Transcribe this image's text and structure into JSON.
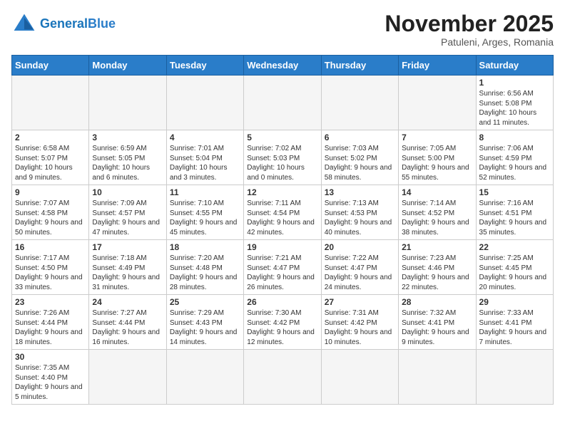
{
  "header": {
    "logo_general": "General",
    "logo_blue": "Blue",
    "month_title": "November 2025",
    "location": "Patuleni, Arges, Romania"
  },
  "days_of_week": [
    "Sunday",
    "Monday",
    "Tuesday",
    "Wednesday",
    "Thursday",
    "Friday",
    "Saturday"
  ],
  "weeks": [
    [
      {
        "day": "",
        "info": ""
      },
      {
        "day": "",
        "info": ""
      },
      {
        "day": "",
        "info": ""
      },
      {
        "day": "",
        "info": ""
      },
      {
        "day": "",
        "info": ""
      },
      {
        "day": "",
        "info": ""
      },
      {
        "day": "1",
        "info": "Sunrise: 6:56 AM\nSunset: 5:08 PM\nDaylight: 10 hours and 11 minutes."
      }
    ],
    [
      {
        "day": "2",
        "info": "Sunrise: 6:58 AM\nSunset: 5:07 PM\nDaylight: 10 hours and 9 minutes."
      },
      {
        "day": "3",
        "info": "Sunrise: 6:59 AM\nSunset: 5:05 PM\nDaylight: 10 hours and 6 minutes."
      },
      {
        "day": "4",
        "info": "Sunrise: 7:01 AM\nSunset: 5:04 PM\nDaylight: 10 hours and 3 minutes."
      },
      {
        "day": "5",
        "info": "Sunrise: 7:02 AM\nSunset: 5:03 PM\nDaylight: 10 hours and 0 minutes."
      },
      {
        "day": "6",
        "info": "Sunrise: 7:03 AM\nSunset: 5:02 PM\nDaylight: 9 hours and 58 minutes."
      },
      {
        "day": "7",
        "info": "Sunrise: 7:05 AM\nSunset: 5:00 PM\nDaylight: 9 hours and 55 minutes."
      },
      {
        "day": "8",
        "info": "Sunrise: 7:06 AM\nSunset: 4:59 PM\nDaylight: 9 hours and 52 minutes."
      }
    ],
    [
      {
        "day": "9",
        "info": "Sunrise: 7:07 AM\nSunset: 4:58 PM\nDaylight: 9 hours and 50 minutes."
      },
      {
        "day": "10",
        "info": "Sunrise: 7:09 AM\nSunset: 4:57 PM\nDaylight: 9 hours and 47 minutes."
      },
      {
        "day": "11",
        "info": "Sunrise: 7:10 AM\nSunset: 4:55 PM\nDaylight: 9 hours and 45 minutes."
      },
      {
        "day": "12",
        "info": "Sunrise: 7:11 AM\nSunset: 4:54 PM\nDaylight: 9 hours and 42 minutes."
      },
      {
        "day": "13",
        "info": "Sunrise: 7:13 AM\nSunset: 4:53 PM\nDaylight: 9 hours and 40 minutes."
      },
      {
        "day": "14",
        "info": "Sunrise: 7:14 AM\nSunset: 4:52 PM\nDaylight: 9 hours and 38 minutes."
      },
      {
        "day": "15",
        "info": "Sunrise: 7:16 AM\nSunset: 4:51 PM\nDaylight: 9 hours and 35 minutes."
      }
    ],
    [
      {
        "day": "16",
        "info": "Sunrise: 7:17 AM\nSunset: 4:50 PM\nDaylight: 9 hours and 33 minutes."
      },
      {
        "day": "17",
        "info": "Sunrise: 7:18 AM\nSunset: 4:49 PM\nDaylight: 9 hours and 31 minutes."
      },
      {
        "day": "18",
        "info": "Sunrise: 7:20 AM\nSunset: 4:48 PM\nDaylight: 9 hours and 28 minutes."
      },
      {
        "day": "19",
        "info": "Sunrise: 7:21 AM\nSunset: 4:47 PM\nDaylight: 9 hours and 26 minutes."
      },
      {
        "day": "20",
        "info": "Sunrise: 7:22 AM\nSunset: 4:47 PM\nDaylight: 9 hours and 24 minutes."
      },
      {
        "day": "21",
        "info": "Sunrise: 7:23 AM\nSunset: 4:46 PM\nDaylight: 9 hours and 22 minutes."
      },
      {
        "day": "22",
        "info": "Sunrise: 7:25 AM\nSunset: 4:45 PM\nDaylight: 9 hours and 20 minutes."
      }
    ],
    [
      {
        "day": "23",
        "info": "Sunrise: 7:26 AM\nSunset: 4:44 PM\nDaylight: 9 hours and 18 minutes."
      },
      {
        "day": "24",
        "info": "Sunrise: 7:27 AM\nSunset: 4:44 PM\nDaylight: 9 hours and 16 minutes."
      },
      {
        "day": "25",
        "info": "Sunrise: 7:29 AM\nSunset: 4:43 PM\nDaylight: 9 hours and 14 minutes."
      },
      {
        "day": "26",
        "info": "Sunrise: 7:30 AM\nSunset: 4:42 PM\nDaylight: 9 hours and 12 minutes."
      },
      {
        "day": "27",
        "info": "Sunrise: 7:31 AM\nSunset: 4:42 PM\nDaylight: 9 hours and 10 minutes."
      },
      {
        "day": "28",
        "info": "Sunrise: 7:32 AM\nSunset: 4:41 PM\nDaylight: 9 hours and 9 minutes."
      },
      {
        "day": "29",
        "info": "Sunrise: 7:33 AM\nSunset: 4:41 PM\nDaylight: 9 hours and 7 minutes."
      }
    ],
    [
      {
        "day": "30",
        "info": "Sunrise: 7:35 AM\nSunset: 4:40 PM\nDaylight: 9 hours and 5 minutes."
      },
      {
        "day": "",
        "info": ""
      },
      {
        "day": "",
        "info": ""
      },
      {
        "day": "",
        "info": ""
      },
      {
        "day": "",
        "info": ""
      },
      {
        "day": "",
        "info": ""
      },
      {
        "day": "",
        "info": ""
      }
    ]
  ]
}
